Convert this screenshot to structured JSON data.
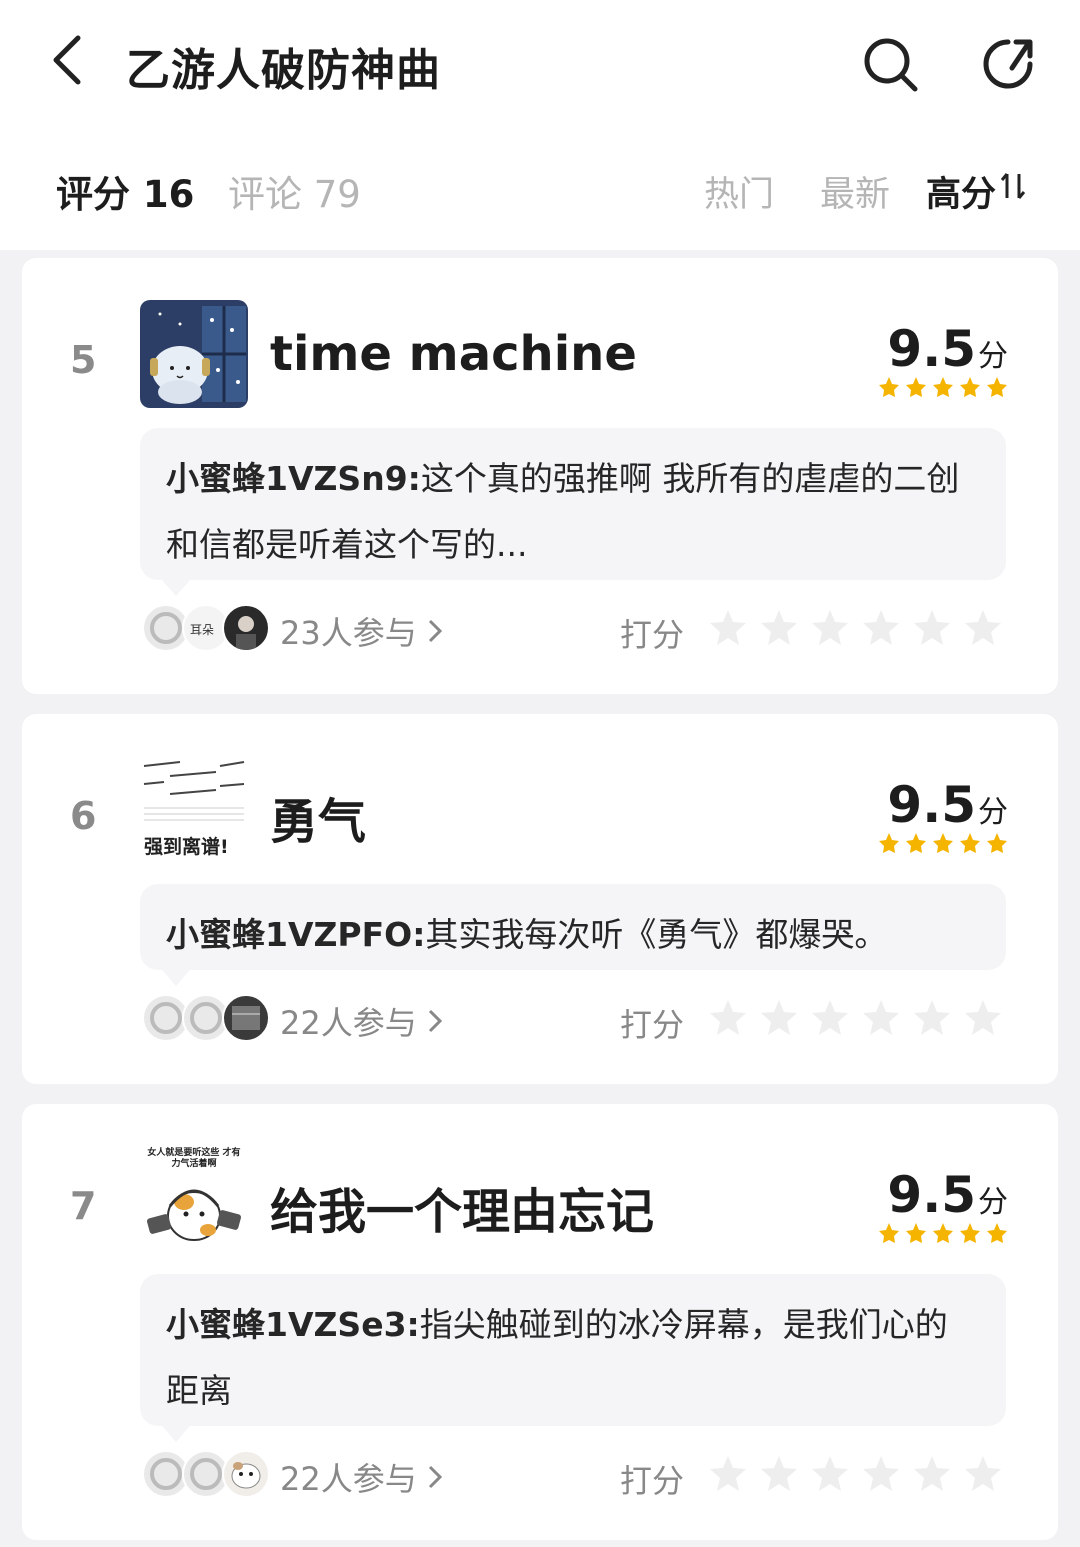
{
  "header": {
    "title": "乙游人破防神曲",
    "back_icon": "back-arrow-icon",
    "search_icon": "search-icon",
    "share_icon": "share-icon"
  },
  "tabs": {
    "score": "评分 16",
    "comments": "评论 79"
  },
  "sort": {
    "hot": "热门",
    "new": "最新",
    "high": "高分",
    "high_icon": "sort-icon"
  },
  "colors": {
    "star_filled": "#f5b400",
    "star_empty": "#eeeeee",
    "background": "#f2f2f4"
  },
  "items": [
    {
      "rank": "5",
      "title": "time machine",
      "score": "9.5",
      "score_unit": "分",
      "stars": 5,
      "comment_user": "小蜜蜂1VZSn9:",
      "comment_text": "这个真的强推啊 我所有的虐虐的二创和信都是听着这个写的...",
      "participants": "23人参与",
      "rate_label": "打分",
      "cover_caption": ""
    },
    {
      "rank": "6",
      "title": "勇气",
      "score": "9.5",
      "score_unit": "分",
      "stars": 5,
      "comment_user": "小蜜蜂1VZPFO:",
      "comment_text": "其实我每次听《勇气》都爆哭。",
      "participants": "22人参与",
      "rate_label": "打分",
      "cover_caption": "强到离谱!"
    },
    {
      "rank": "7",
      "title": "给我一个理由忘记",
      "score": "9.5",
      "score_unit": "分",
      "stars": 5,
      "comment_user": "小蜜蜂1VZSe3:",
      "comment_text": "指尖触碰到的冰冷屏幕，是我们心的距离",
      "participants": "22人参与",
      "rate_label": "打分",
      "cover_caption": "女人就是要听这些 才有力气活着啊"
    }
  ]
}
